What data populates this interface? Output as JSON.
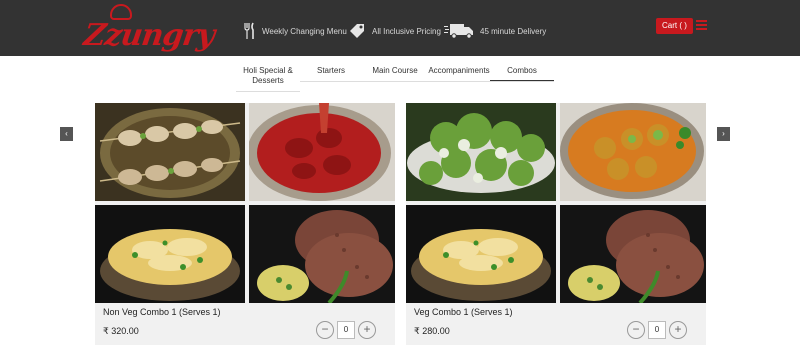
{
  "header": {
    "logo_text": "Zzungry",
    "features": [
      {
        "icon": "fork-knife-icon",
        "label": "Weekly Changing Menu"
      },
      {
        "icon": "price-tag-icon",
        "label": "All Inclusive Pricing"
      },
      {
        "icon": "delivery-truck-icon",
        "label": "45 minute Delivery"
      }
    ],
    "cart_label": "Cart ( )",
    "menu_icon": "hamburger-icon"
  },
  "tabs": [
    {
      "label": "Holi Special & Desserts",
      "active": false
    },
    {
      "label": "Starters",
      "active": false
    },
    {
      "label": "Main Course",
      "active": false
    },
    {
      "label": "Accompaniments",
      "active": false
    },
    {
      "label": "Combos",
      "active": true
    }
  ],
  "carousel": {
    "prev_icon": "chevron-left-icon",
    "next_icon": "chevron-right-icon"
  },
  "products": [
    {
      "name": "Non Veg Combo 1 (Serves 1)",
      "price": "₹ 320.00",
      "quantity": "0"
    },
    {
      "name": "Veg Combo 1 (Serves 1)",
      "price": "₹ 280.00",
      "quantity": "0"
    }
  ],
  "colors": {
    "brand": "#c8191e",
    "header_bg": "#333333",
    "card_bg": "#f1f1f1"
  }
}
